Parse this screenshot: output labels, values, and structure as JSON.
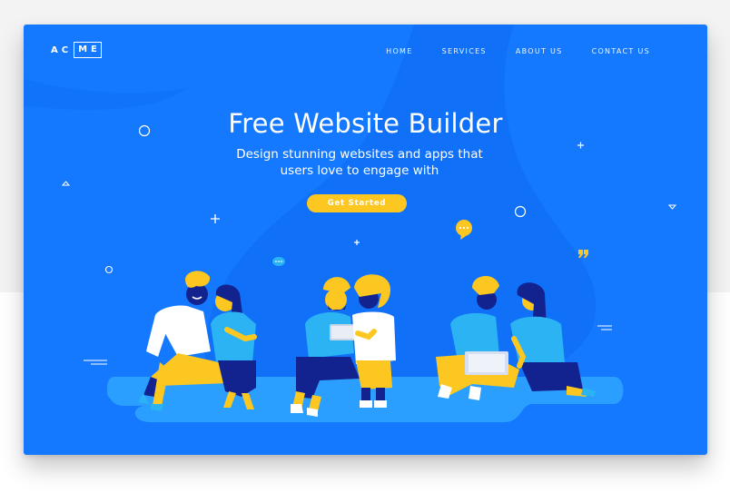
{
  "brand": {
    "logo_left": "AC",
    "logo_boxed": "ME"
  },
  "nav": {
    "items": [
      "HOME",
      "SERVICES",
      "ABOUT US",
      "CONTACT US"
    ]
  },
  "hero": {
    "headline": "Free Website Builder",
    "subline": "Design stunning websites and apps that users love to engage with",
    "cta_label": "Get Started"
  },
  "colors": {
    "background": "#1479ff",
    "accent": "#fdc722",
    "navy": "#12228f",
    "light_blue": "#2bb3f4"
  },
  "icons": [
    "circle-decoration-icon",
    "plus-decoration-icon",
    "triangle-decoration-icon",
    "chat-bubble-icon",
    "quote-icon",
    "dash-lines-icon"
  ]
}
